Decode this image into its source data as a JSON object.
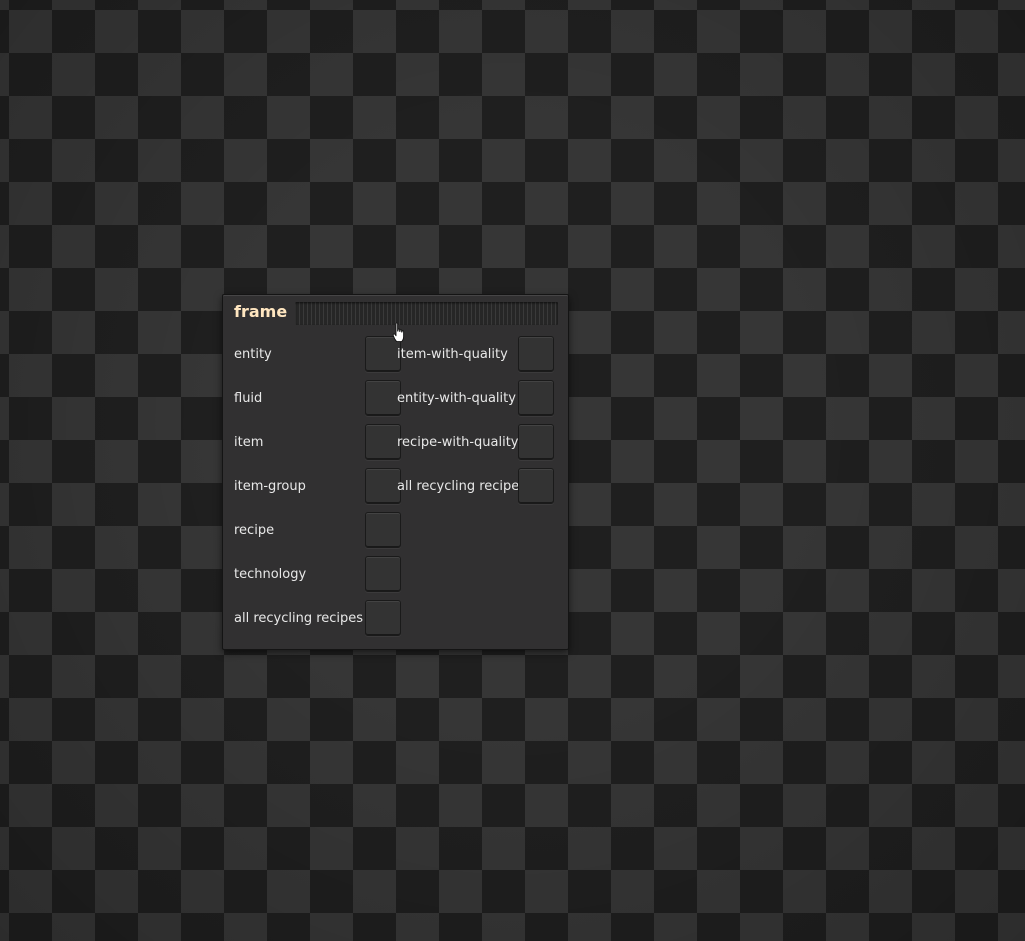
{
  "frame": {
    "title": "frame",
    "left_column": [
      {
        "label": "entity"
      },
      {
        "label": "fluid"
      },
      {
        "label": "item"
      },
      {
        "label": "item-group"
      },
      {
        "label": "recipe"
      },
      {
        "label": "technology"
      },
      {
        "label": "all recycling recipes"
      }
    ],
    "right_column": [
      {
        "label": "item-with-quality"
      },
      {
        "label": "entity-with-quality"
      },
      {
        "label": "recipe-with-quality"
      },
      {
        "label": "all recycling recipes"
      }
    ]
  },
  "colors": {
    "title": "#ffe6c0",
    "label": "#e8e8e8",
    "panel": "#313031"
  },
  "cursor": {
    "icon": "hand-pointer-icon"
  }
}
